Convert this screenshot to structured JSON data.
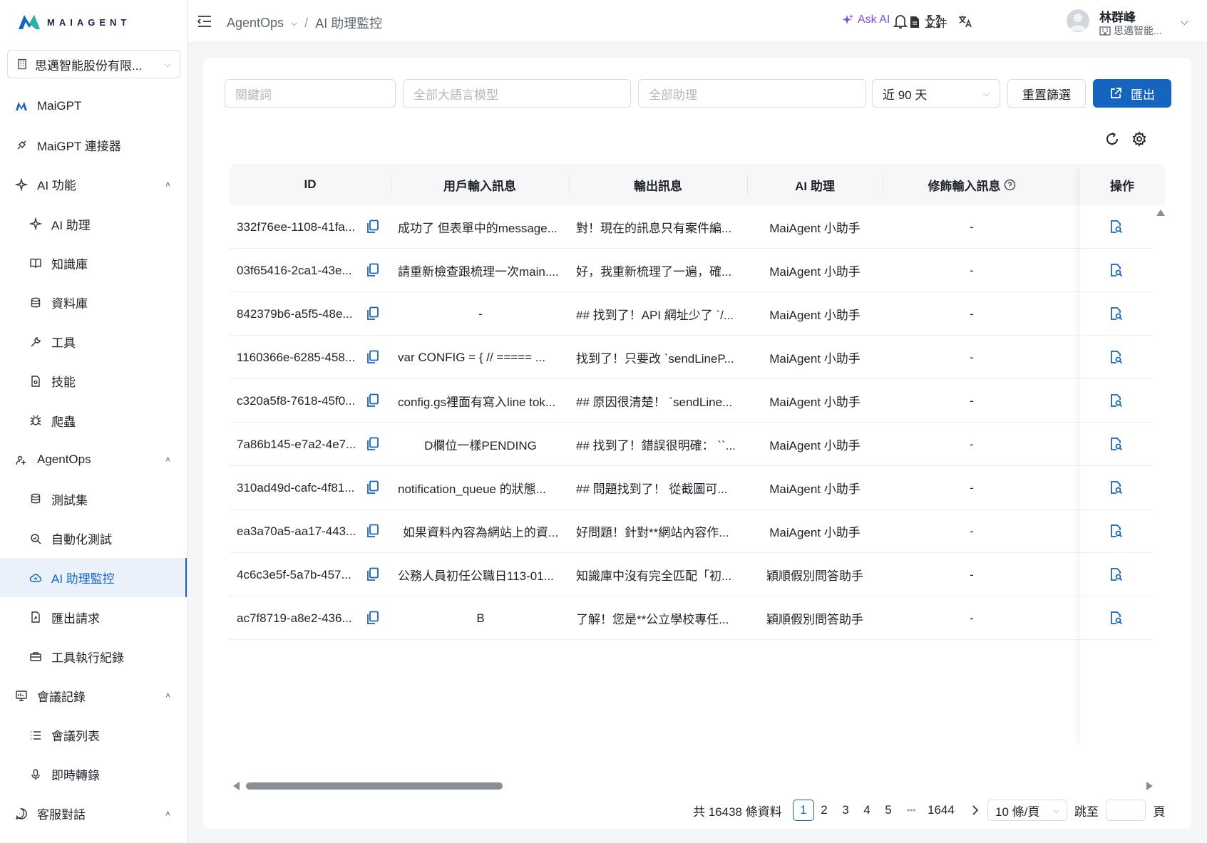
{
  "brand": {
    "name": "MAIAGENT",
    "color": "#1565c0"
  },
  "org_select": {
    "label": "思邁智能股份有限..."
  },
  "sidebar": {
    "items": [
      {
        "label": "MaiGPT",
        "icon": "maigpt-logo-icon"
      },
      {
        "label": "MaiGPT 連接器",
        "icon": "plug-icon"
      },
      {
        "label": "AI 功能",
        "icon": "sparkle-icon",
        "expanded": true
      },
      {
        "label": "AI 助理",
        "icon": "sparkle-icon"
      },
      {
        "label": "知識庫",
        "icon": "book-icon"
      },
      {
        "label": "資料庫",
        "icon": "database-icon"
      },
      {
        "label": "工具",
        "icon": "wrench-icon"
      },
      {
        "label": "技能",
        "icon": "file-gear-icon"
      },
      {
        "label": "爬蟲",
        "icon": "bug-icon"
      },
      {
        "label": "AgentOps",
        "icon": "agentops-icon",
        "expanded": true
      },
      {
        "label": "測試集",
        "icon": "database-icon"
      },
      {
        "label": "自動化測試",
        "icon": "search-check-icon"
      },
      {
        "label": "AI 助理監控",
        "icon": "cloud-icon",
        "active": true
      },
      {
        "label": "匯出請求",
        "icon": "file-export-icon"
      },
      {
        "label": "工具執行紀錄",
        "icon": "toolbox-icon"
      },
      {
        "label": "會議記錄",
        "icon": "meeting-icon",
        "expanded": true
      },
      {
        "label": "會議列表",
        "icon": "list-icon"
      },
      {
        "label": "即時轉錄",
        "icon": "mic-icon"
      },
      {
        "label": "客服對話",
        "icon": "chat-icon",
        "expanded": true
      }
    ]
  },
  "header": {
    "breadcrumb": [
      "AgentOps",
      "AI 助理監控"
    ],
    "ask_ai": "Ask AI",
    "docs": "文件",
    "user_name": "林群峰",
    "user_org": "思邁智能..."
  },
  "filters": {
    "keyword_placeholder": "關鍵詞",
    "model_placeholder": "全部大語言模型",
    "assistant_placeholder": "全部助理",
    "range_value": "近 90 天",
    "reset_label": "重置篩選",
    "export_label": "匯出"
  },
  "table": {
    "columns": [
      "ID",
      "用戶輸入訊息",
      "輸出訊息",
      "AI 助理",
      "修飾輸入訊息",
      "操作"
    ],
    "rows": [
      {
        "id": "332f76ee-1108-41fa...",
        "input": "成功了 但表單中的message...",
        "output": "對！現在的訊息只有案件編...",
        "assistant": "MaiAgent 小助手",
        "refined": "-"
      },
      {
        "id": "03f65416-2ca1-43e...",
        "input": "請重新檢查跟梳理一次main....",
        "output": "好，我重新梳理了一遍，確...",
        "assistant": "MaiAgent 小助手",
        "refined": "-"
      },
      {
        "id": "842379b6-a5f5-48e...",
        "input": "-",
        "output": "## 找到了！API 網址少了 `/...",
        "assistant": "MaiAgent 小助手",
        "refined": "-"
      },
      {
        "id": "1160366e-6285-458...",
        "input": "var CONFIG = { // ===== ...",
        "output": "找到了！只要改 `sendLineP...",
        "assistant": "MaiAgent 小助手",
        "refined": "-"
      },
      {
        "id": "c320a5f8-7618-45f0...",
        "input": "config.gs裡面有寫入line tok...",
        "output": "## 原因很清楚！ `sendLine...",
        "assistant": "MaiAgent 小助手",
        "refined": "-"
      },
      {
        "id": "7a86b145-e7a2-4e7...",
        "input": "D欄位一樣PENDING",
        "output": "## 找到了！錯誤很明確： ``...",
        "assistant": "MaiAgent 小助手",
        "refined": "-"
      },
      {
        "id": "310ad49d-cafc-4f81...",
        "input": "notification_queue 的狀態...",
        "output": "## 問題找到了！ 從截圖可...",
        "assistant": "MaiAgent 小助手",
        "refined": "-"
      },
      {
        "id": "ea3a70a5-aa17-443...",
        "input": "如果資料內容為網站上的資...",
        "output": "好問題！針對**網站內容作...",
        "assistant": "MaiAgent 小助手",
        "refined": "-"
      },
      {
        "id": "4c6c3e5f-5a7b-457...",
        "input": "公務人員初任公職日113-01...",
        "output": "知識庫中沒有完全匹配「初...",
        "assistant": "穎順假別問答助手",
        "refined": "-"
      },
      {
        "id": "ac7f8719-a8e2-436...",
        "input": "B",
        "output": "了解！您是**公立學校專任...",
        "assistant": "穎順假別問答助手",
        "refined": "-"
      }
    ]
  },
  "pagination": {
    "total": "共 16438 條資料",
    "pages": [
      "1",
      "2",
      "3",
      "4",
      "5"
    ],
    "ellipsis": "•••",
    "last": "1644",
    "current": "1",
    "page_size": "10 條/頁",
    "jump_label": "跳至",
    "page_label": "頁"
  }
}
